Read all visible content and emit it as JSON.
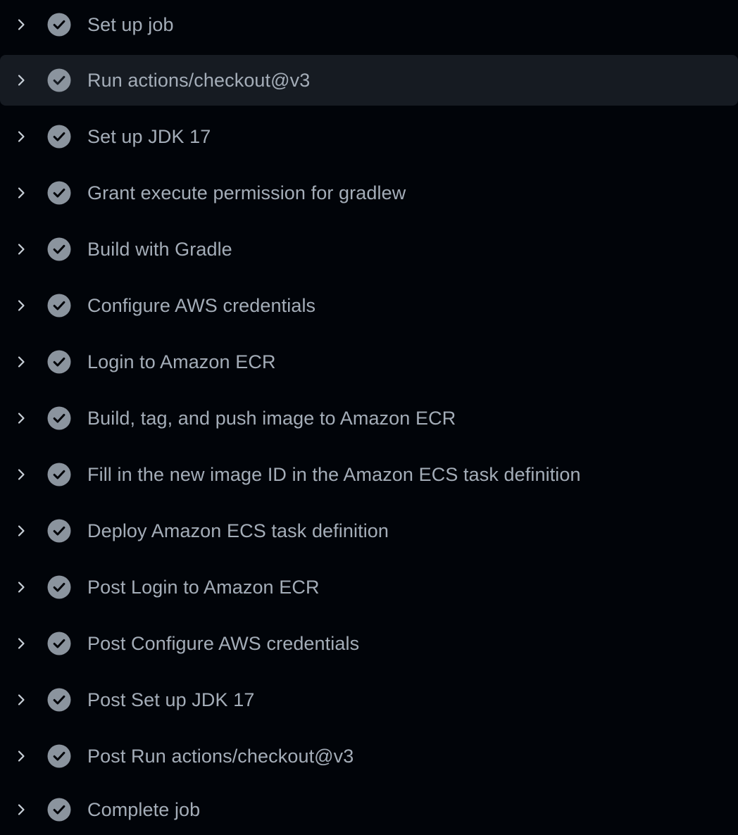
{
  "steps": [
    {
      "label": "Set up job",
      "status": "success",
      "expanded": false
    },
    {
      "label": "Run actions/checkout@v3",
      "status": "success",
      "expanded": false,
      "hovered": true
    },
    {
      "label": "Set up JDK 17",
      "status": "success",
      "expanded": false
    },
    {
      "label": "Grant execute permission for gradlew",
      "status": "success",
      "expanded": false
    },
    {
      "label": "Build with Gradle",
      "status": "success",
      "expanded": false
    },
    {
      "label": "Configure AWS credentials",
      "status": "success",
      "expanded": false
    },
    {
      "label": "Login to Amazon ECR",
      "status": "success",
      "expanded": false
    },
    {
      "label": "Build, tag, and push image to Amazon ECR",
      "status": "success",
      "expanded": false
    },
    {
      "label": "Fill in the new image ID in the Amazon ECS task definition",
      "status": "success",
      "expanded": false
    },
    {
      "label": "Deploy Amazon ECS task definition",
      "status": "success",
      "expanded": false
    },
    {
      "label": "Post Login to Amazon ECR",
      "status": "success",
      "expanded": false
    },
    {
      "label": "Post Configure AWS credentials",
      "status": "success",
      "expanded": false
    },
    {
      "label": "Post Set up JDK 17",
      "status": "success",
      "expanded": false
    },
    {
      "label": "Post Run actions/checkout@v3",
      "status": "success",
      "expanded": false
    },
    {
      "label": "Complete job",
      "status": "success",
      "expanded": false
    }
  ],
  "icons": {
    "chevron": "chevron-right-icon",
    "status": "check-circle-fill-icon"
  },
  "colors": {
    "background": "#010409",
    "row_hover": "#161b22",
    "text": "#a4adb8",
    "icon": "#8b949e",
    "chevron": "#c9d1d9"
  }
}
